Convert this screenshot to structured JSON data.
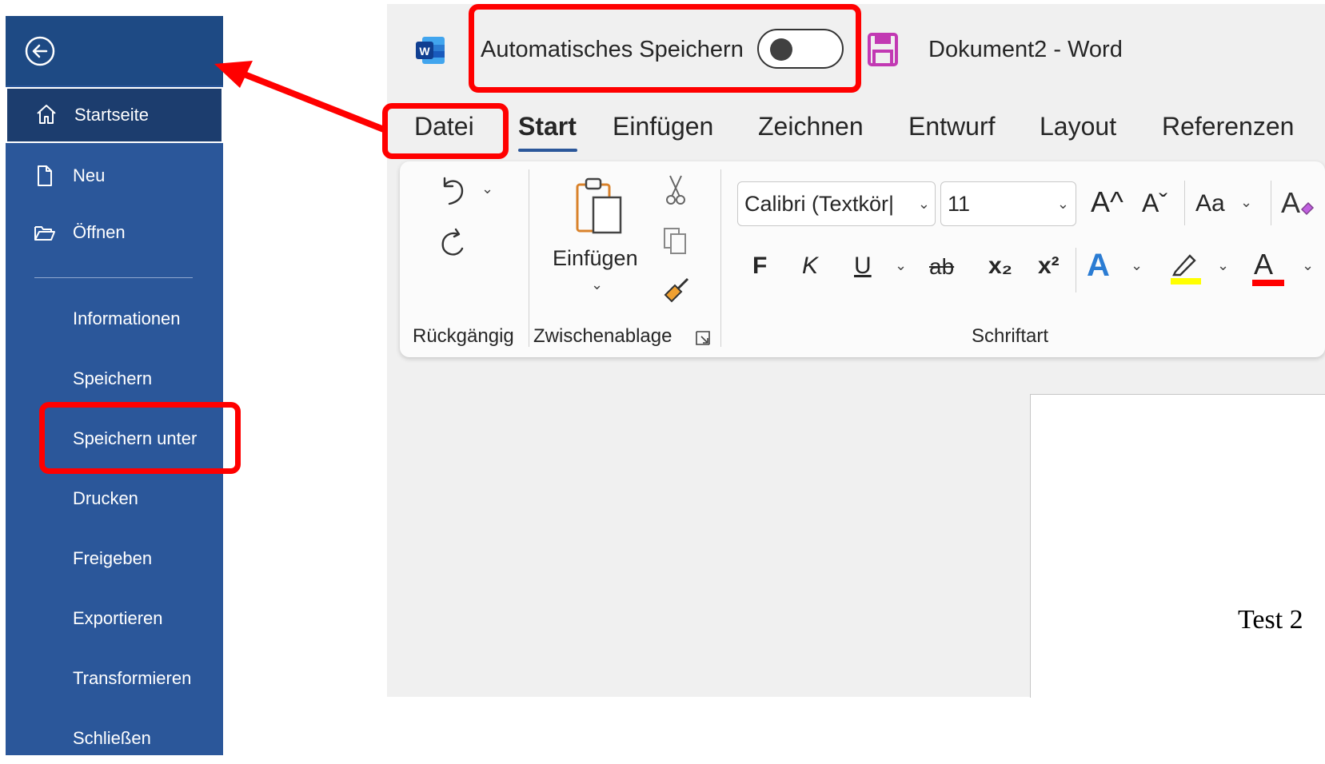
{
  "sidebar": {
    "back_icon": "arrow-left-circle-icon",
    "items": [
      {
        "label": "Startseite",
        "icon": "home-icon"
      },
      {
        "label": "Neu",
        "icon": "new-document-icon"
      },
      {
        "label": "Öffnen",
        "icon": "folder-open-icon"
      },
      {
        "label": "Informationen"
      },
      {
        "label": "Speichern"
      },
      {
        "label": "Speichern unter"
      },
      {
        "label": "Drucken"
      },
      {
        "label": "Freigeben"
      },
      {
        "label": "Exportieren"
      },
      {
        "label": "Transformieren"
      },
      {
        "label": "Schließen"
      }
    ]
  },
  "titlebar": {
    "autosave_label": "Automatisches Speichern",
    "autosave_state": "off",
    "document_title": "Dokument2  -  Word"
  },
  "tabs": [
    "Datei",
    "Start",
    "Einfügen",
    "Zeichnen",
    "Entwurf",
    "Layout",
    "Referenzen"
  ],
  "ribbon": {
    "undo_group_label": "Rückgängig",
    "clipboard": {
      "paste_label": "Einfügen",
      "group_label": "Zwischenablage"
    },
    "font": {
      "font_name": "Calibri (Textkör|",
      "font_size": "11",
      "group_label": "Schriftart",
      "bold": "F",
      "italic": "K",
      "underline": "U",
      "strikethrough": "ab",
      "subscript": "x₂",
      "superscript": "x²",
      "grow": "A^",
      "shrink": "Aˇ",
      "case": "Aa",
      "font_color": "A",
      "text_effects": "A"
    }
  },
  "document": {
    "text": "Test 2"
  },
  "colors": {
    "sidebar": "#2b579a",
    "sidebar_selected": "#1c3d6e",
    "annotation": "#ff0000",
    "highlight": "#ffff00",
    "font_color_bar": "#ff0000"
  }
}
